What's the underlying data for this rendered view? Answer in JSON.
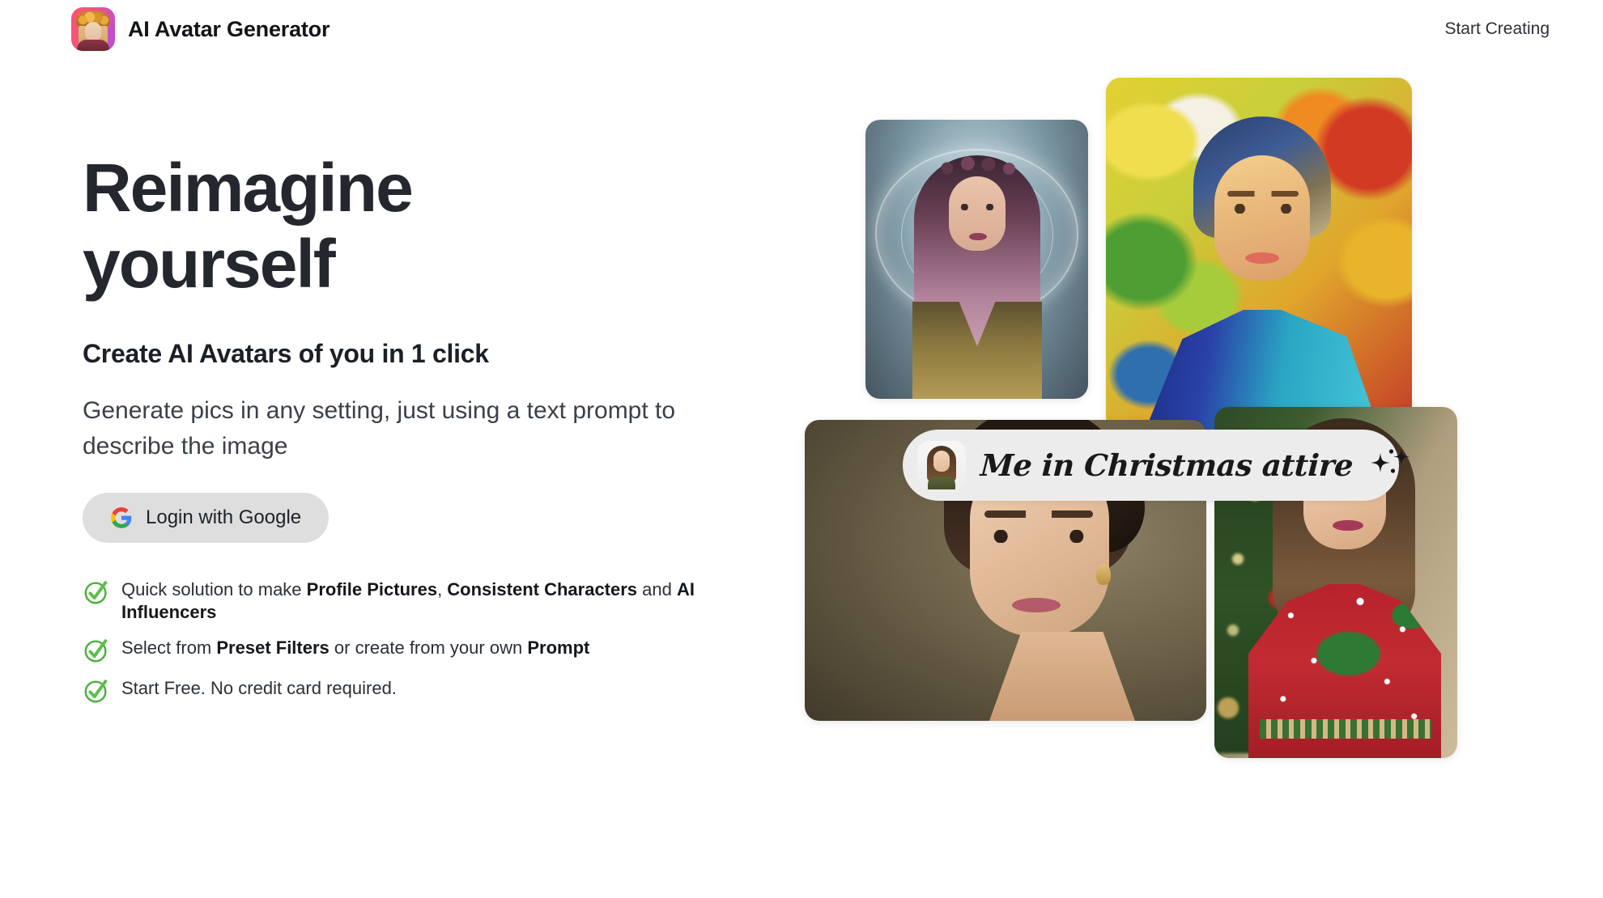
{
  "header": {
    "logo_icon": "app-logo-avatar-icon",
    "brand_title": "AI Avatar Generator",
    "nav_link": "Start Creating"
  },
  "hero": {
    "title_line_1": "Reimagine",
    "title_line_2": "yourself",
    "subtitle": "Create AI Avatars of you in 1 click",
    "description": "Generate pics in any setting, just using a text prompt to describe the image",
    "google_button": {
      "label": "Login with Google",
      "icon": "google-g-icon",
      "bg_color": "#dedede"
    },
    "features": [
      {
        "icon": "green-check-circle-icon",
        "segments": [
          {
            "text": "Quick solution to make ",
            "bold": false
          },
          {
            "text": "Profile Pictures",
            "bold": true
          },
          {
            "text": ", ",
            "bold": false
          },
          {
            "text": "Consistent Characters",
            "bold": true
          },
          {
            "text": " and ",
            "bold": false
          },
          {
            "text": "AI Influencers",
            "bold": true
          }
        ]
      },
      {
        "icon": "green-check-circle-icon",
        "segments": [
          {
            "text": "Select from ",
            "bold": false
          },
          {
            "text": "Preset Filters",
            "bold": true
          },
          {
            "text": " or create from your own ",
            "bold": false
          },
          {
            "text": "Prompt",
            "bold": true
          }
        ]
      },
      {
        "icon": "green-check-circle-icon",
        "segments": [
          {
            "text": "Start Free. No credit card required.",
            "bold": false
          }
        ]
      }
    ]
  },
  "collage": {
    "photos": [
      {
        "name": "photo-fantasy-portrait",
        "alt": "Woman with pink ombre hair and glowing halo, fantasy style"
      },
      {
        "name": "photo-painterly-portrait",
        "alt": "Oil-painting style portrait of woman in turquoise top"
      },
      {
        "name": "photo-elegant-portrait",
        "alt": "Elegant studio portrait of woman with braided updo"
      },
      {
        "name": "photo-christmas-portrait",
        "alt": "Woman in red Christmas sweater by a decorated tree"
      }
    ],
    "prompt_pill": {
      "avatar_icon": "user-reference-photo-icon",
      "text": "Me in Christmas attire",
      "sparkle_icon": "sparkles-icon",
      "bg_color": "#ececec"
    }
  },
  "colors": {
    "page_background": "#ffffff",
    "heading": "#24282e",
    "body_text": "#3b4149",
    "check_green": "#4caf3f",
    "logo_gradient_start": "#f8576f",
    "logo_gradient_end": "#b44ce0"
  }
}
